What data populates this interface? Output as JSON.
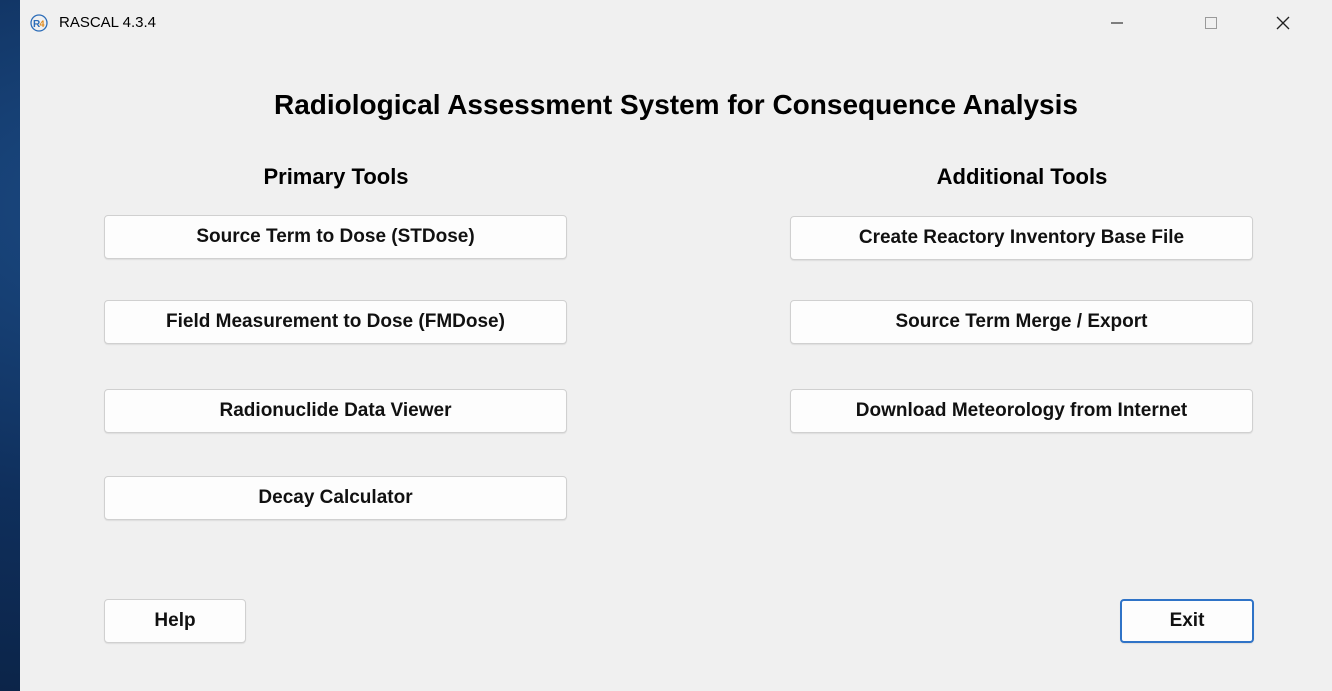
{
  "window": {
    "title": "RASCAL 4.3.4",
    "icon": "rascal-r4-icon",
    "controls": [
      "minimize",
      "maximize",
      "close"
    ]
  },
  "main": {
    "heading": "Radiological Assessment System for Consequence Analysis",
    "primary": {
      "title": "Primary Tools",
      "buttons": [
        "Source Term to Dose (STDose)",
        "Field Measurement to Dose (FMDose)",
        "Radionuclide Data Viewer",
        "Decay Calculator"
      ]
    },
    "additional": {
      "title": "Additional Tools",
      "buttons": [
        "Create Reactory Inventory Base File",
        "Source Term Merge / Export",
        "Download Meteorology from Internet"
      ]
    }
  },
  "footer": {
    "help_label": "Help",
    "exit_label": "Exit"
  },
  "colors": {
    "window_bg": "#f0f0f0",
    "button_bg": "#fdfdfd",
    "focus_border": "#2f73c7",
    "icon_blue": "#2b6cb8",
    "icon_orange": "#e08a1c",
    "desktop_bg": "#0f2f5c"
  }
}
